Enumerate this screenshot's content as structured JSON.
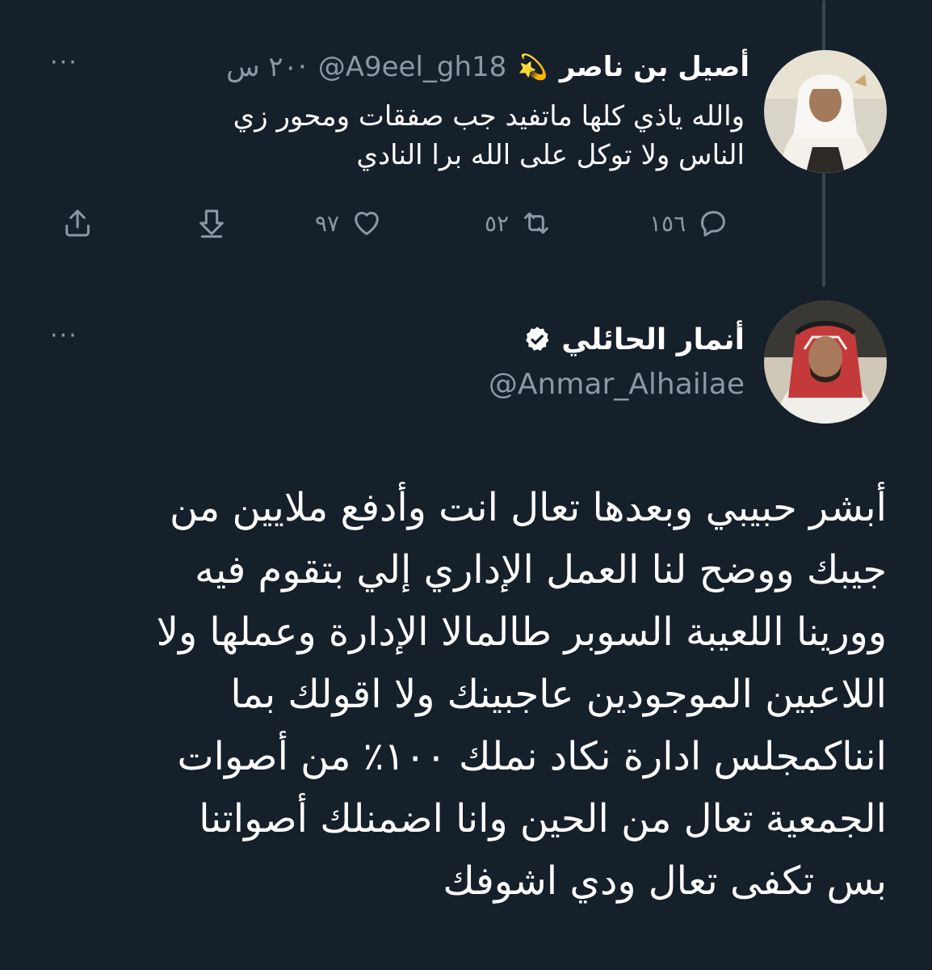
{
  "reply_tweet": {
    "display_name": "أصيل بن ناصر",
    "name_emoji": "💫",
    "handle": "@A9eel_gh18",
    "time_ago": "٢٠ س",
    "separator": "·",
    "text_lines": [
      "والله ياذي كلها ماتفيد جب صفقات ومحور زي",
      "الناس ولا توكل على الله برا النادي"
    ],
    "more_label": "···",
    "stats": {
      "replies": "١٥٦",
      "retweets": "٥٢",
      "likes": "٩٧"
    },
    "icons": [
      "reply-icon",
      "retweet-icon",
      "like-icon",
      "download-icon",
      "share-icon"
    ]
  },
  "main_tweet": {
    "display_name": "أنمار الحائلي",
    "handle": "@Anmar_Alhailae",
    "verified": true,
    "more_label": "···",
    "text_lines": [
      "أبشر حبيبي وبعدها تعال انت وأدفع ملايين من",
      "جيبك ووضح لنا العمل الإداري إلي بتقوم فيه",
      "وورينا اللعيبة السوبر طالمالا الإدارة وعملها ولا",
      "اللاعبين الموجودين عاجبينك ولا اقولك بما",
      "انناكمجلس ادارة نكاد نملك ١٠٠٪ من أصوات",
      "الجمعية تعال من الحين وانا اضمنلك أصواتنا",
      "بس تكفى تعال ودي اشوفك"
    ]
  },
  "colors": {
    "background": "#15202b",
    "secondary_text": "#8b98a5",
    "thread_line": "#38444d",
    "primary_text": "#ffffff"
  }
}
